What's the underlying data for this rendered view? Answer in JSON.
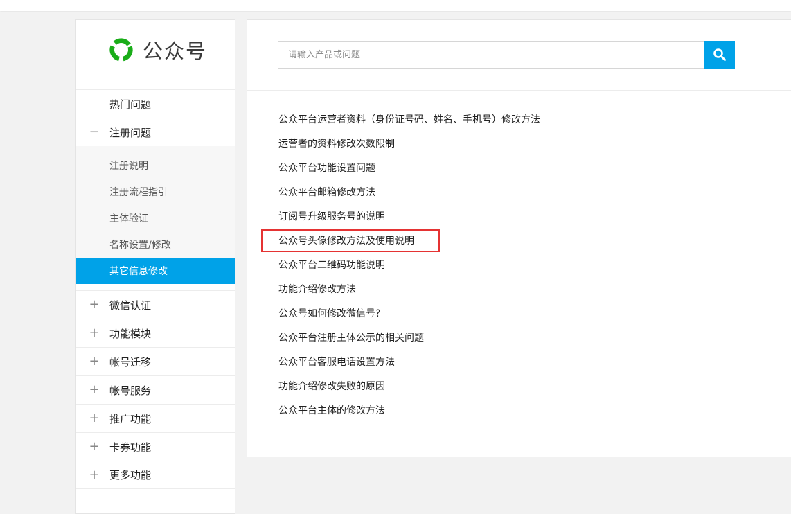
{
  "logo": {
    "text": "公众号",
    "brand_color": "#1aad19"
  },
  "sidebar": {
    "items": [
      {
        "label": "热门问题",
        "sign": ""
      },
      {
        "label": "注册问题",
        "sign": "−",
        "children": [
          "注册说明",
          "注册流程指引",
          "主体验证",
          "名称设置/修改",
          "其它信息修改"
        ],
        "active_child": "其它信息修改"
      },
      {
        "label": "微信认证",
        "sign": "+"
      },
      {
        "label": "功能模块",
        "sign": "+"
      },
      {
        "label": "帐号迁移",
        "sign": "+"
      },
      {
        "label": "帐号服务",
        "sign": "+"
      },
      {
        "label": "推广功能",
        "sign": "+"
      },
      {
        "label": "卡券功能",
        "sign": "+"
      },
      {
        "label": "更多功能",
        "sign": "+"
      }
    ]
  },
  "search": {
    "placeholder": "请输入产品或问题",
    "button_icon": "search-icon",
    "accent": "#00a2e8"
  },
  "questions": [
    "公众平台运营者资料（身份证号码、姓名、手机号）修改方法",
    "运营者的资料修改次数限制",
    "公众平台功能设置问题",
    "公众平台邮箱修改方法",
    "订阅号升级服务号的说明",
    "公众号头像修改方法及使用说明",
    "公众平台二维码功能说明",
    "功能介绍修改方法",
    "公众号如何修改微信号?",
    "公众平台注册主体公示的相关问题",
    "公众平台客服电话设置方法",
    "功能介绍修改失败的原因",
    "公众平台主体的修改方法"
  ],
  "highlighted_question": "公众号头像修改方法及使用说明",
  "highlight_color": "#e53333"
}
